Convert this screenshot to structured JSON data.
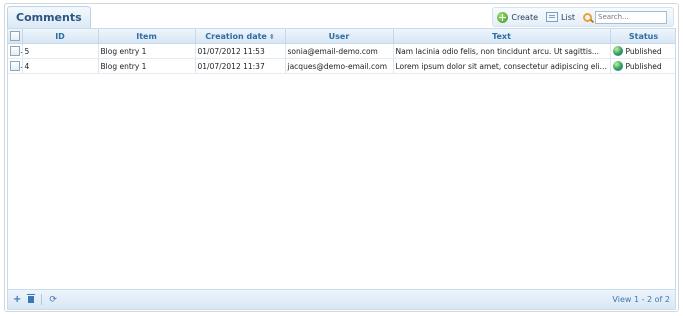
{
  "panel": {
    "title": "Comments"
  },
  "toolbar": {
    "create_label": "Create",
    "list_label": "List",
    "search_placeholder": "Search..."
  },
  "table": {
    "columns": [
      "",
      "ID",
      "Item",
      "Creation date",
      "User",
      "Text",
      "Status"
    ],
    "sorted_column": "Creation date",
    "rows": [
      {
        "id": "5",
        "item": "Blog entry 1",
        "date": "01/07/2012 11:53",
        "user": "sonia@email-demo.com",
        "text": "Nam lacinia odio felis, non tincidunt arcu. Ut sagittis...",
        "status": "Published"
      },
      {
        "id": "4",
        "item": "Blog entry 1",
        "date": "01/07/2012 11:37",
        "user": "jacques@demo-email.com",
        "text": "Lorem ipsum dolor sit amet, consectetur adipiscing elit...",
        "status": "Published"
      }
    ]
  },
  "footer": {
    "view_info": "View 1 - 2 of 2"
  },
  "colors": {
    "header_text": "#2e6da4",
    "accent": "#3a78b5",
    "published_icon": "#2f9b58"
  },
  "icons": {
    "create": "plus-circle-icon",
    "list": "list-icon",
    "search": "magnifier-icon",
    "add": "plus-icon",
    "delete": "trash-icon",
    "refresh": "refresh-icon",
    "status": "globe-icon"
  }
}
